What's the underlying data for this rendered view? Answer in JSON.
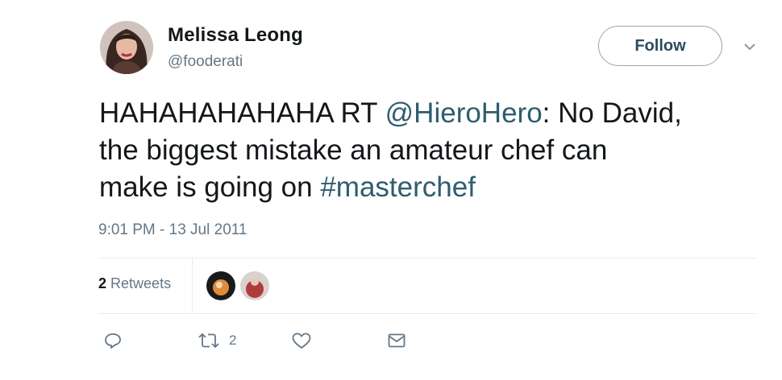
{
  "author": {
    "display_name": "Melissa Leong",
    "handle": "@fooderati"
  },
  "follow_button": {
    "label": "Follow"
  },
  "tweet": {
    "text_part1": "HAHAHAHAHAHA RT ",
    "mention": "@HieroHero",
    "text_part2": ": No David,",
    "text_line2": "the biggest mistake an amateur chef can",
    "text_line3_prefix": "make is going on ",
    "hashtag": "#masterchef",
    "timestamp": "9:01 PM - 13 Jul 2011"
  },
  "stats": {
    "retweet_count": "2",
    "retweet_label": "Retweets"
  },
  "actions": {
    "reply_icon": "reply-icon",
    "retweet_icon": "retweet-icon",
    "retweet_count": "2",
    "like_icon": "heart-icon",
    "message_icon": "envelope-icon"
  },
  "colors": {
    "link": "#2f5d6e",
    "secondary_text": "#657786",
    "divider": "#e6ecf0"
  }
}
